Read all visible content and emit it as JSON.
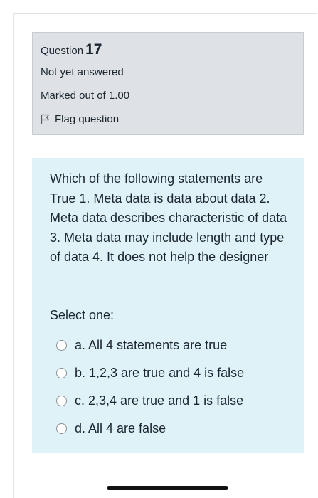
{
  "question_info": {
    "label": "Question",
    "number": "17",
    "state": "Not yet answered",
    "grade": "Marked out of 1.00",
    "flag_label": "Flag question"
  },
  "question_text": "Which of the following statements are True 1. Meta data is data about data 2. Meta data describes characteristic of data 3. Meta data may include length and type of data 4. It does not help the designer",
  "prompt": "Select one:",
  "answers": [
    {
      "label": "a. All 4 statements are true",
      "selected": false
    },
    {
      "label": "b. 1,2,3 are true and 4 is false",
      "selected": false
    },
    {
      "label": "c. 2,3,4 are true and 1 is false",
      "selected": false
    },
    {
      "label": "d. All 4 are false",
      "selected": false
    }
  ],
  "icons": {
    "flag": "flag-icon",
    "radio": "radio-button"
  },
  "colors": {
    "info_background": "#dee2e6",
    "question_background": "#def2f8",
    "text": "#1c2630",
    "radio_border": "#8a8f94"
  }
}
